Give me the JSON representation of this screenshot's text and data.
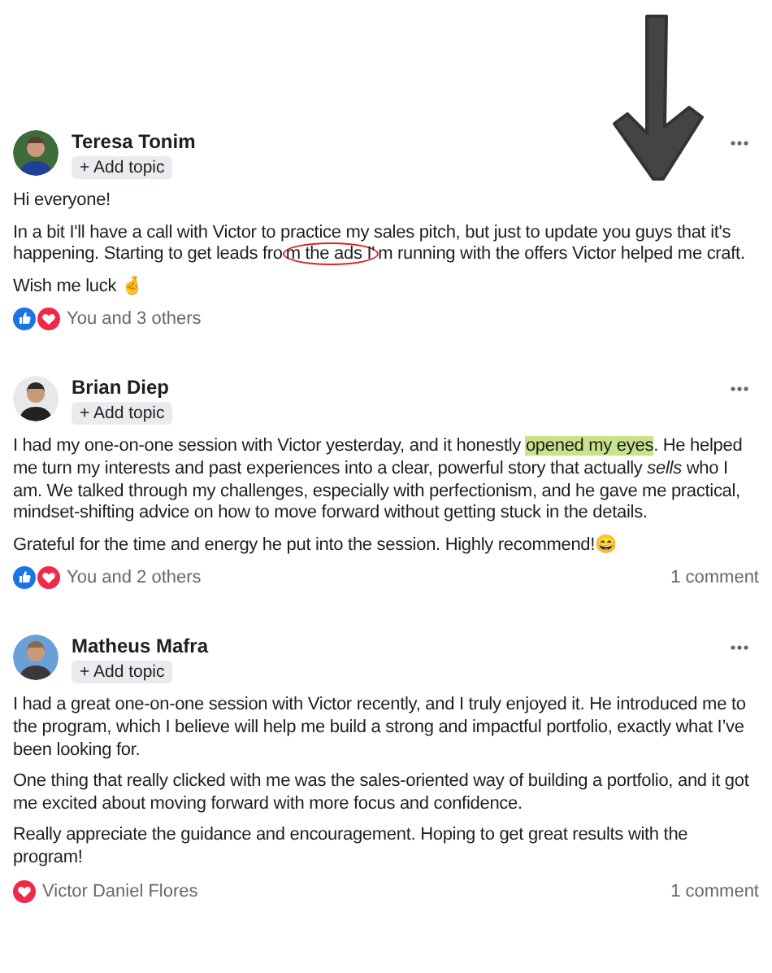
{
  "posts": [
    {
      "author": "Teresa Tonim",
      "topic_button": "+ Add topic",
      "paragraphs": [
        [
          {
            "kind": "plain",
            "text": "Hi everyone!"
          }
        ],
        [
          {
            "kind": "plain",
            "text": "In a bit I'll have a call with Victor to practice my sales pitch, but just to update you guys that it's happening. Starting to get leads fro"
          },
          {
            "kind": "circled",
            "text": "m the ads I'"
          },
          {
            "kind": "plain",
            "text": "m running with the offers Victor helped me craft."
          }
        ],
        [
          {
            "kind": "plain",
            "text": "Wish me luck 🤞"
          }
        ]
      ],
      "reactions": [
        {
          "kind": "like"
        },
        {
          "kind": "love"
        }
      ],
      "reaction_text": "You and 3 others"
    },
    {
      "author": "Brian Diep",
      "topic_button": "+ Add topic",
      "paragraphs": [
        [
          {
            "kind": "plain",
            "text": "I had my one-on-one session with Victor yesterday, and it honestly "
          },
          {
            "kind": "highlight",
            "text": "opened my eyes"
          },
          {
            "kind": "plain",
            "text": ". He helped me turn my interests and past experiences into a clear, powerful story that actually *sells* who I am. We talked through my challenges, especially with perfectionism, and he gave me practical, mindset-shifting advice on how to move forward without getting stuck in the details."
          }
        ],
        [
          {
            "kind": "plain",
            "text": "Grateful for the time and energy he put into the session. Highly recommend!😄"
          }
        ]
      ],
      "reactions": [
        {
          "kind": "like"
        },
        {
          "kind": "love"
        }
      ],
      "reaction_text": "You and 2 others",
      "comments": "1 comment"
    },
    {
      "author": "Matheus Mafra",
      "topic_button": "+ Add topic",
      "paragraphs": [
        [
          {
            "kind": "plain",
            "text": "I had a great one-on-one session with Victor recently, and I truly enjoyed it. He introduced me to the program, which I believe will help me build a strong and impactful portfolio, exactly what I’ve been looking for."
          }
        ],
        [
          {
            "kind": "plain",
            "text": "One thing that really clicked with me was the sales-oriented way of building a portfolio, and it got me excited about moving forward with more focus and confidence."
          }
        ],
        [
          {
            "kind": "plain",
            "text": "Really appreciate the guidance and encouragement. Hoping to get great results with the program!"
          }
        ]
      ],
      "reactions": [
        {
          "kind": "love"
        }
      ],
      "reaction_text": "Victor Daniel Flores",
      "comments": "1 comment"
    }
  ]
}
